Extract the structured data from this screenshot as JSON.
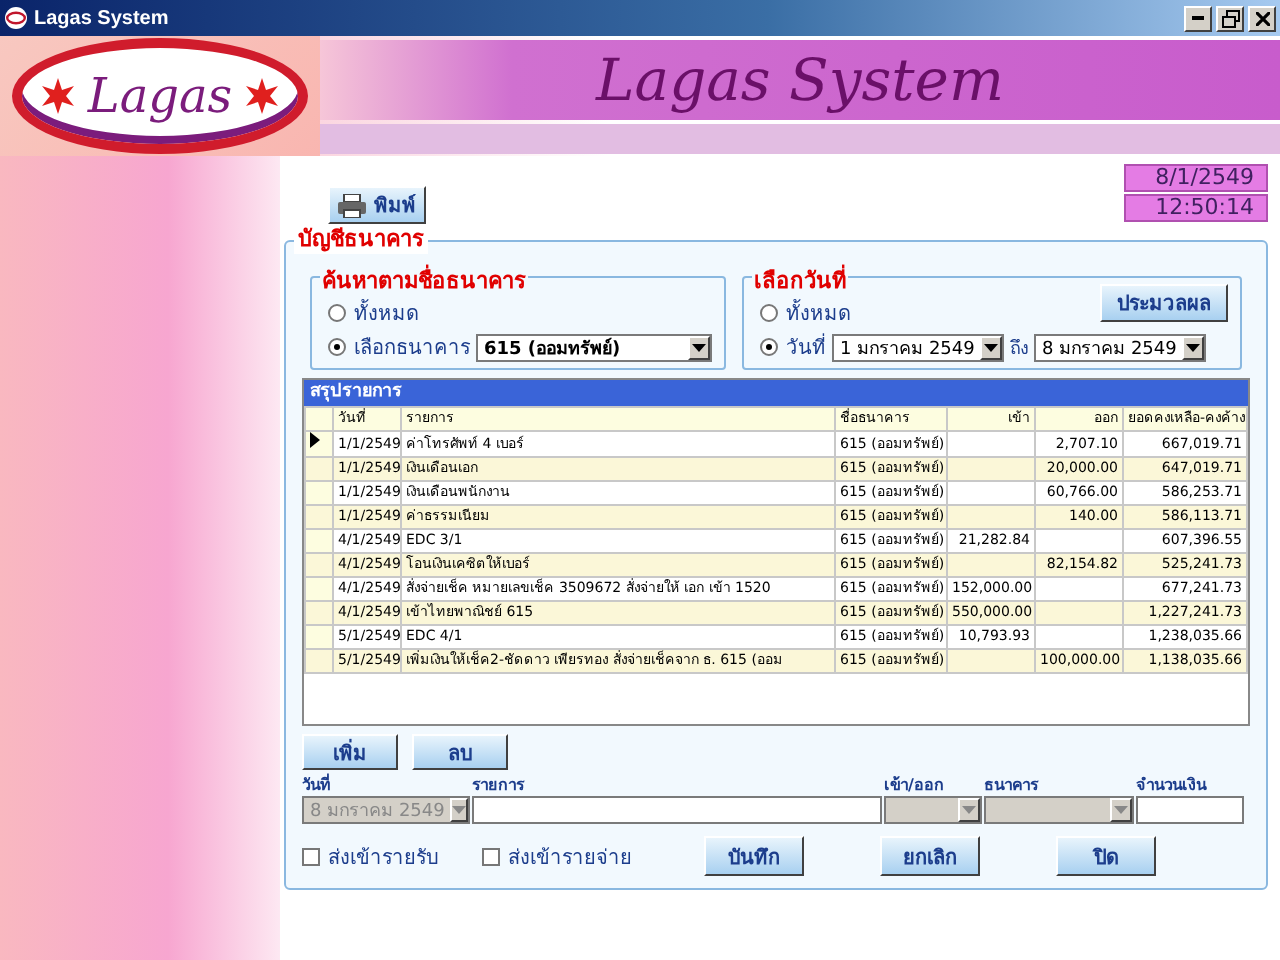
{
  "window": {
    "title": "Lagas System"
  },
  "header": {
    "logo_text": "Lagas",
    "banner_title": "Lagas System"
  },
  "toolbar": {
    "print_button": "พิมพ์",
    "date": "8/1/2549",
    "time": "12:50:14"
  },
  "panel": {
    "title": "บัญชีธนาคาร",
    "bank_filter": {
      "title": "ค้นหาตามชื่อธนาคาร",
      "options": [
        {
          "label": "ทั้งหมด",
          "selected": false
        },
        {
          "label": "เลือกธนาคาร",
          "selected": true
        }
      ],
      "bank_value": "615 (ออมทรัพย์)"
    },
    "date_filter": {
      "title": "เลือกวันที่",
      "options": [
        {
          "label": "ทั้งหมด",
          "selected": false
        },
        {
          "label": "วันที่",
          "selected": true
        }
      ],
      "from": "1  มกราคม   2549",
      "to_label": "ถึง",
      "to": "8  มกราคม   2549"
    },
    "process_button": "ประมวลผล",
    "table": {
      "caption": "สรุปรายการ",
      "columns": [
        "วันที่",
        "รายการ",
        "ชื่อธนาคาร",
        "เข้า",
        "ออก",
        "ยอดคงเหลือ-คงค้าง"
      ],
      "rows": [
        {
          "current": true,
          "cells": [
            "1/1/2549",
            "ค่าโทรศัพท์ 4 เบอร์",
            "615 (ออมทรัพย์)",
            "",
            "2,707.10",
            "667,019.71"
          ]
        },
        {
          "current": false,
          "cells": [
            "1/1/2549",
            "เงินเดือนเอก",
            "615 (ออมทรัพย์)",
            "",
            "20,000.00",
            "647,019.71"
          ]
        },
        {
          "current": false,
          "cells": [
            "1/1/2549",
            "เงินเดือนพนักงาน",
            "615 (ออมทรัพย์)",
            "",
            "60,766.00",
            "586,253.71"
          ]
        },
        {
          "current": false,
          "cells": [
            "1/1/2549",
            "ค่าธรรมเนียม",
            "615 (ออมทรัพย์)",
            "",
            "140.00",
            "586,113.71"
          ]
        },
        {
          "current": false,
          "cells": [
            "4/1/2549",
            "EDC 3/1",
            "615 (ออมทรัพย์)",
            "21,282.84",
            "",
            "607,396.55"
          ]
        },
        {
          "current": false,
          "cells": [
            "4/1/2549",
            "โอนเงินเคซิตให้เบอร์",
            "615 (ออมทรัพย์)",
            "",
            "82,154.82",
            "525,241.73"
          ]
        },
        {
          "current": false,
          "cells": [
            "4/1/2549",
            "สั่งจ่ายเช็ค หมายเลขเช็ค 3509672 สั่งจ่ายให้ เอก เข้า 1520",
            "615 (ออมทรัพย์)",
            "152,000.00",
            "",
            "677,241.73"
          ]
        },
        {
          "current": false,
          "cells": [
            "4/1/2549",
            "เข้าไทยพาณิชย์ 615",
            "615 (ออมทรัพย์)",
            "550,000.00",
            "",
            "1,227,241.73"
          ]
        },
        {
          "current": false,
          "cells": [
            "5/1/2549",
            "EDC 4/1",
            "615 (ออมทรัพย์)",
            "10,793.93",
            "",
            "1,238,035.66"
          ]
        },
        {
          "current": false,
          "cells": [
            "5/1/2549",
            "เพิ่มเงินให้เช็ค2-ชัดดาว เพียรทอง สั่งจ่ายเช็คจาก ธ. 615 (ออม",
            "615 (ออมทรัพย์)",
            "",
            "100,000.00",
            "1,138,035.66"
          ]
        }
      ]
    },
    "row_buttons": [
      "เพิ่ม",
      "ลบ"
    ],
    "entry_fields": [
      {
        "label": "วันที่",
        "kind": "combo",
        "value": "8  มกราคม   2549",
        "disabled": true
      },
      {
        "label": "รายการ",
        "kind": "text",
        "disabled": false
      },
      {
        "label": "เข้า/ออก",
        "kind": "combo",
        "disabled": true
      },
      {
        "label": "ธนาคาร",
        "kind": "combo",
        "disabled": true
      },
      {
        "label": "จำนวนเงิน",
        "kind": "text",
        "disabled": false
      }
    ],
    "checkboxes": [
      {
        "label": "ส่งเข้ารายรับ",
        "checked": false
      },
      {
        "label": "ส่งเข้ารายจ่าย",
        "checked": false
      }
    ],
    "actions": [
      "บันทึก",
      "ยกเลิก",
      "ปิด"
    ]
  }
}
